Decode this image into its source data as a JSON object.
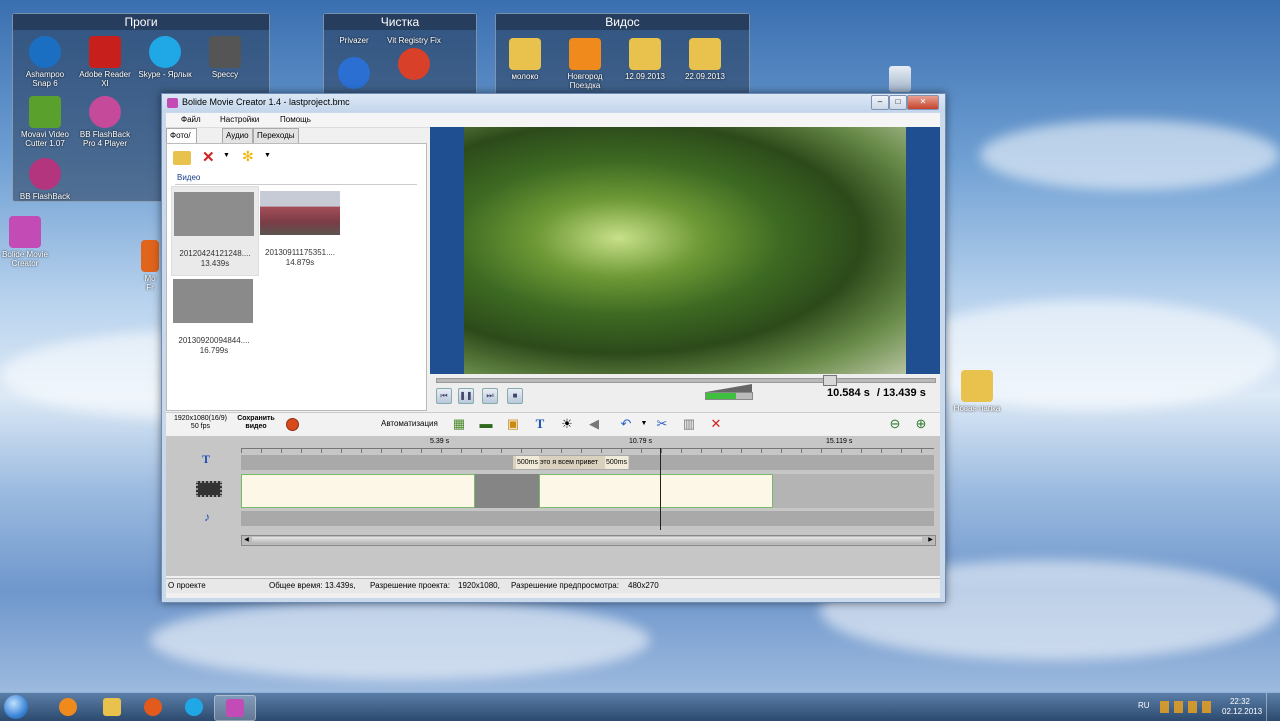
{
  "desktop": {
    "fences": [
      {
        "title": "Проги"
      },
      {
        "title": "Чистка"
      },
      {
        "title": "Видос"
      }
    ],
    "progi_icons": [
      {
        "label": "Ashampoo Snap 6",
        "icon": "ashampoo-icon",
        "color": "#1b6fc2"
      },
      {
        "label": "Adobe Reader XI",
        "icon": "adobe-reader-icon",
        "color": "#c7201c"
      },
      {
        "label": "Skype - Ярлык",
        "icon": "skype-icon",
        "color": "#1fa8e5"
      },
      {
        "label": "Speccy",
        "icon": "speccy-icon",
        "color": "#555555"
      },
      {
        "label": "Movavi Video Cutter 1.07",
        "icon": "video-cutter-icon",
        "color": "#5aa02c"
      },
      {
        "label": "BB FlashBack Pro 4 Player",
        "icon": "bb-player-icon",
        "color": "#c64a9a"
      },
      {
        "label": "BB FlashBack",
        "icon": "bb-flashback-icon",
        "color": "#b3357e"
      }
    ],
    "chistka_icons": [
      {
        "label": "Privazer",
        "icon": "privazer-icon",
        "color": "#2a6fd1"
      },
      {
        "label": "Vit Registry Fix",
        "icon": "registry-fix-icon",
        "color": "#d8402a"
      }
    ],
    "vidos_icons": [
      {
        "label": "молоко",
        "icon": "folder-icon",
        "color": "#e8c24c"
      },
      {
        "label": "Новгород Поездка",
        "icon": "vlc-folder-icon",
        "color": "#f08a1c"
      },
      {
        "label": "12.09.2013",
        "icon": "folder-icon",
        "color": "#e8c24c"
      },
      {
        "label": "22.09.2013",
        "icon": "folder-icon",
        "color": "#e8c24c"
      }
    ],
    "loose_icons": [
      {
        "label": "Bolide Movie Creator",
        "icon": "bolide-icon",
        "color": "#c24bb5"
      },
      {
        "label": "Новая папка",
        "icon": "folder-icon",
        "color": "#e8c24c"
      },
      {
        "label": "Mo Fr",
        "icon": "app-icon",
        "color": "#e0641c"
      }
    ]
  },
  "window": {
    "title": "Bolide Movie Creator 1.4 - lastproject.bmc",
    "menu": [
      "Файл",
      "Настройки",
      "Помощь"
    ],
    "tabs": [
      "Фото/Видео",
      "Аудио",
      "Переходы"
    ],
    "section_label": "Видео",
    "media": [
      {
        "name": "20120424121248....",
        "duration": "13.439s"
      },
      {
        "name": "20130911175351....",
        "duration": "14.879s"
      },
      {
        "name": "20130920094844....",
        "duration": "16.799s"
      }
    ],
    "time_current": "10.584 s",
    "time_total": "/ 13.439 s",
    "playback_progress": 0.787,
    "volume_level": 0.65,
    "resolution_info": "1920x1080(16/9)",
    "fps_info": "50 fps",
    "save_video_label": "Сохранить видео",
    "automation_label": "Автоматизация",
    "ruler": [
      {
        "label": "5.39 s"
      },
      {
        "label": "10.79 s"
      },
      {
        "label": "15.119 s"
      }
    ],
    "text_clip": {
      "fade_in": "500ms",
      "text": "это я всем привет",
      "fade_out": "500ms"
    },
    "status": {
      "about": "О проекте",
      "total_time": "Общее время: 13.439s,",
      "project_res_label": "Разрешение проекта:",
      "project_res": "1920x1080,",
      "preview_res_label": "Разрешение предпросмотра:",
      "preview_res": "480x270"
    }
  },
  "taskbar": {
    "items": [
      {
        "icon": "start-orb-icon",
        "color": "#3d86d8"
      },
      {
        "icon": "media-player-icon",
        "color": "#f08a1c"
      },
      {
        "icon": "explorer-icon",
        "color": "#e8c24c"
      },
      {
        "icon": "firefox-icon",
        "color": "#e25a1c"
      },
      {
        "icon": "skype-icon",
        "color": "#1fa8e5"
      },
      {
        "icon": "bolide-icon",
        "color": "#c24bb5"
      }
    ],
    "lang": "RU",
    "time": "22:32",
    "date": "02.12.2013"
  },
  "colors": {
    "preview_bg": "#1f4e91",
    "clip_border": "#7ab86a",
    "title_bg": "#c9d8ea"
  }
}
